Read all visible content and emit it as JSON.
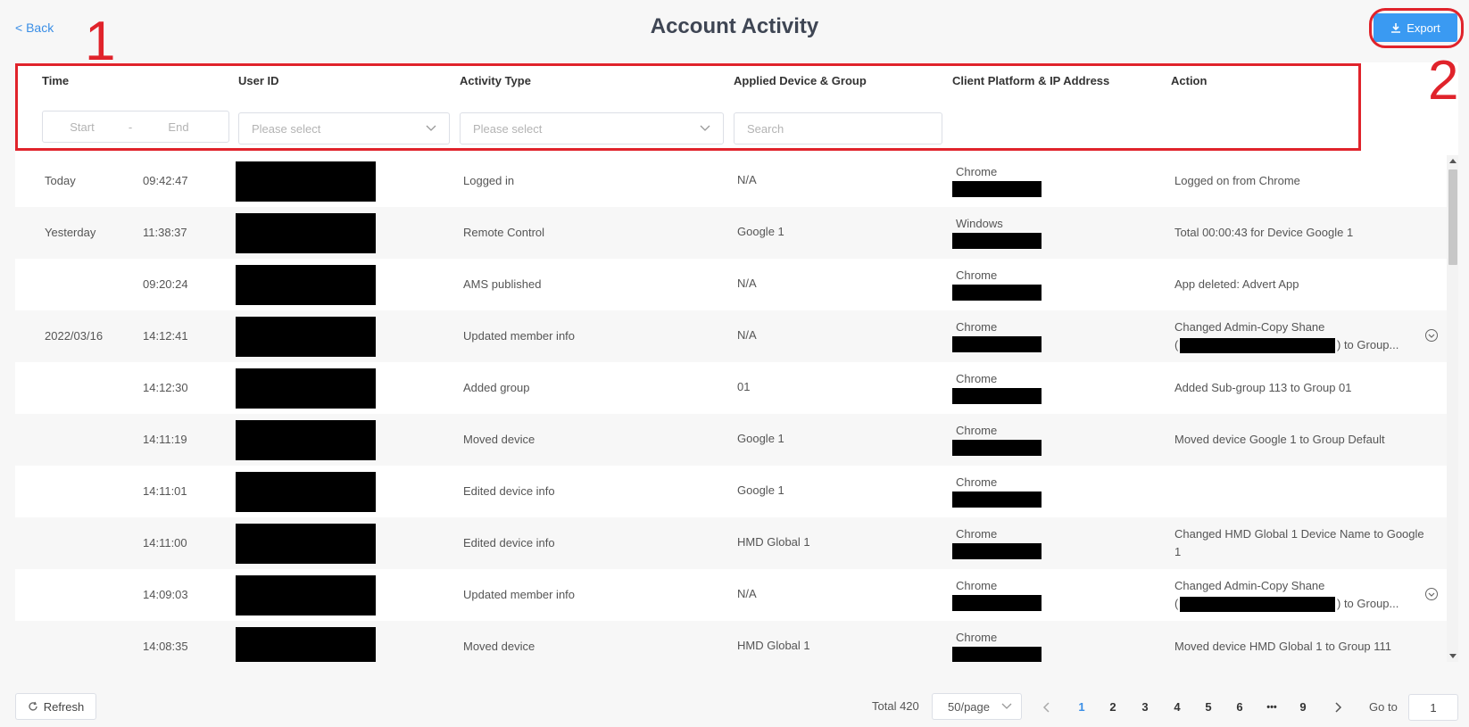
{
  "header": {
    "back_label": "< Back",
    "title": "Account Activity",
    "export_label": "Export"
  },
  "annotations": {
    "one": "1",
    "two": "2"
  },
  "filters": {
    "columns": [
      "Time",
      "User ID",
      "Activity Type",
      "Applied Device & Group",
      "Client Platform & IP Address",
      "Action"
    ],
    "date_start_placeholder": "Start",
    "date_separator": "-",
    "date_end_placeholder": "End",
    "user_id_placeholder": "Please select",
    "activity_type_placeholder": "Please select",
    "device_search_placeholder": "Search"
  },
  "rows": [
    {
      "date": "Today",
      "time": "09:42:47",
      "activity": "Logged in",
      "device": "N/A",
      "platform": "Chrome",
      "action": "Logged on from Chrome",
      "action2": "",
      "expandable": false
    },
    {
      "date": "Yesterday",
      "time": "11:38:37",
      "activity": "Remote Control",
      "device": "Google 1",
      "platform": "Windows",
      "action": "Total 00:00:43 for Device Google 1",
      "action2": "",
      "expandable": false
    },
    {
      "date": "",
      "time": "09:20:24",
      "activity": "AMS published",
      "device": "N/A",
      "platform": "Chrome",
      "action": "App deleted: Advert App",
      "action2": "",
      "expandable": false
    },
    {
      "date": "2022/03/16",
      "time": "14:12:41",
      "activity": "Updated member info",
      "device": "N/A",
      "platform": "Chrome",
      "action": "Changed Admin-Copy Shane",
      "action2": "(",
      "action2_tail": ") to Group...",
      "expandable": true
    },
    {
      "date": "",
      "time": "14:12:30",
      "activity": "Added group",
      "device": "01",
      "platform": "Chrome",
      "action": "Added Sub-group 113 to Group 01",
      "action2": "",
      "expandable": false
    },
    {
      "date": "",
      "time": "14:11:19",
      "activity": "Moved device",
      "device": "Google 1",
      "platform": "Chrome",
      "action": "Moved device Google 1 to Group Default",
      "action2": "",
      "expandable": false
    },
    {
      "date": "",
      "time": "14:11:01",
      "activity": "Edited device info",
      "device": "Google 1",
      "platform": "Chrome",
      "action": "",
      "action2": "",
      "expandable": false
    },
    {
      "date": "",
      "time": "14:11:00",
      "activity": "Edited device info",
      "device": "HMD Global 1",
      "platform": "Chrome",
      "action": "Changed HMD Global 1 Device Name to Google",
      "action2": "1",
      "expandable": false
    },
    {
      "date": "",
      "time": "14:09:03",
      "activity": "Updated member info",
      "device": "N/A",
      "platform": "Chrome",
      "action": "Changed Admin-Copy Shane",
      "action2": "(",
      "action2_tail": ") to Group...",
      "expandable": true
    },
    {
      "date": "",
      "time": "14:08:35",
      "activity": "Moved device",
      "device": "HMD Global 1",
      "platform": "Chrome",
      "action": "Moved device HMD Global 1 to Group 111",
      "action2": "",
      "expandable": false
    }
  ],
  "footer": {
    "refresh_label": "Refresh",
    "total_text": "Total 420",
    "page_size": "50/page",
    "pages": [
      "1",
      "2",
      "3",
      "4",
      "5",
      "6",
      "•••",
      "9"
    ],
    "current_page": "1",
    "goto_label": "Go to",
    "goto_value": "1"
  },
  "colors": {
    "accent": "#3a9af2",
    "annotation": "#e0232b"
  },
  "icons": {
    "export": "download-icon",
    "refresh": "refresh-icon",
    "expand": "chevron-circle-icon"
  }
}
